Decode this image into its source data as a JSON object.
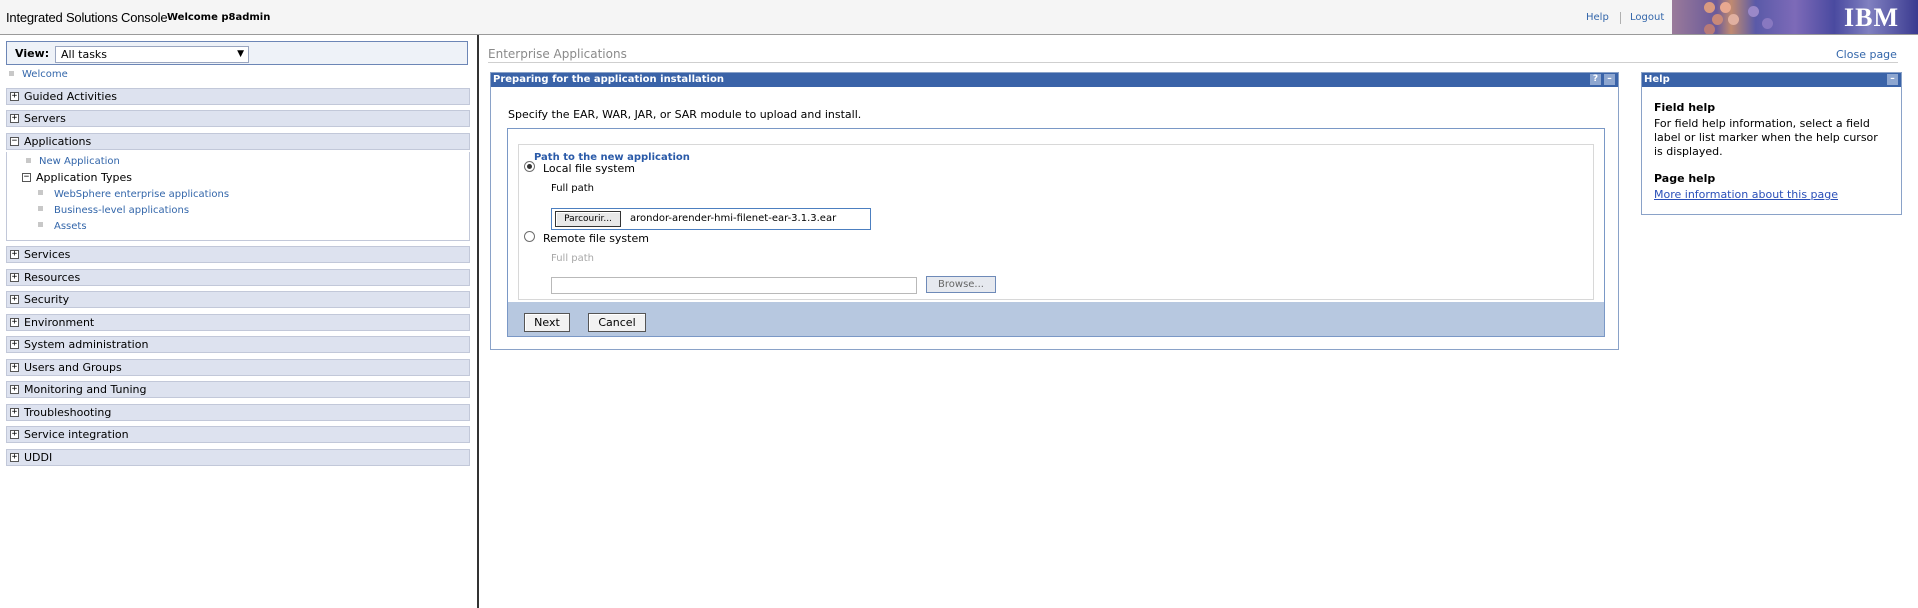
{
  "header": {
    "app_title": "Integrated Solutions Console",
    "welcome": "Welcome p8admin",
    "help_link": "Help",
    "logout_link": "Logout",
    "logo_text": "IBM"
  },
  "sidebar": {
    "view_label": "View:",
    "view_value": "All tasks",
    "welcome_link": "Welcome",
    "sections": {
      "guided_activities": "Guided Activities",
      "servers": "Servers",
      "applications": "Applications",
      "services": "Services",
      "resources": "Resources",
      "security": "Security",
      "environment": "Environment",
      "system_administration": "System administration",
      "users_and_groups": "Users and Groups",
      "monitoring_and_tuning": "Monitoring and Tuning",
      "troubleshooting": "Troubleshooting",
      "service_integration": "Service integration",
      "uddi": "UDDI"
    },
    "applications": {
      "new_application": "New Application",
      "application_types": "Application Types",
      "websphere_enterprise": "WebSphere enterprise applications",
      "business_level": "Business-level applications",
      "assets": "Assets"
    }
  },
  "main": {
    "breadcrumb": "Enterprise Applications",
    "close_page": "Close page",
    "portlet_title": "Preparing for the application installation",
    "instruction": "Specify the EAR, WAR, JAR, or SAR module to upload and install.",
    "legend": "Path to the new application",
    "local_label": "Local file system",
    "local_full_path": "Full path",
    "browse_local_label": "Parcourir...",
    "local_file_value": "arondor-arender-hmi-filenet-ear-3.1.3.ear",
    "remote_label": "Remote file system",
    "remote_full_path": "Full path",
    "browse_remote_label": "Browse...",
    "next_label": "Next",
    "cancel_label": "Cancel",
    "help_button": "?",
    "minimize_button": "–"
  },
  "help": {
    "title": "Help",
    "field_help_title": "Field help",
    "field_help_text": "For field help information, select a field label or list marker when the help cursor is displayed.",
    "page_help_title": "Page help",
    "more_info_link": "More information about this page",
    "minimize_button": "–"
  },
  "colors": {
    "portlet_title_bg": "#3a63a8",
    "nav_row_bg": "#dde2ef",
    "button_bar_bg": "#b7c8e0",
    "link": "#3366aa"
  }
}
